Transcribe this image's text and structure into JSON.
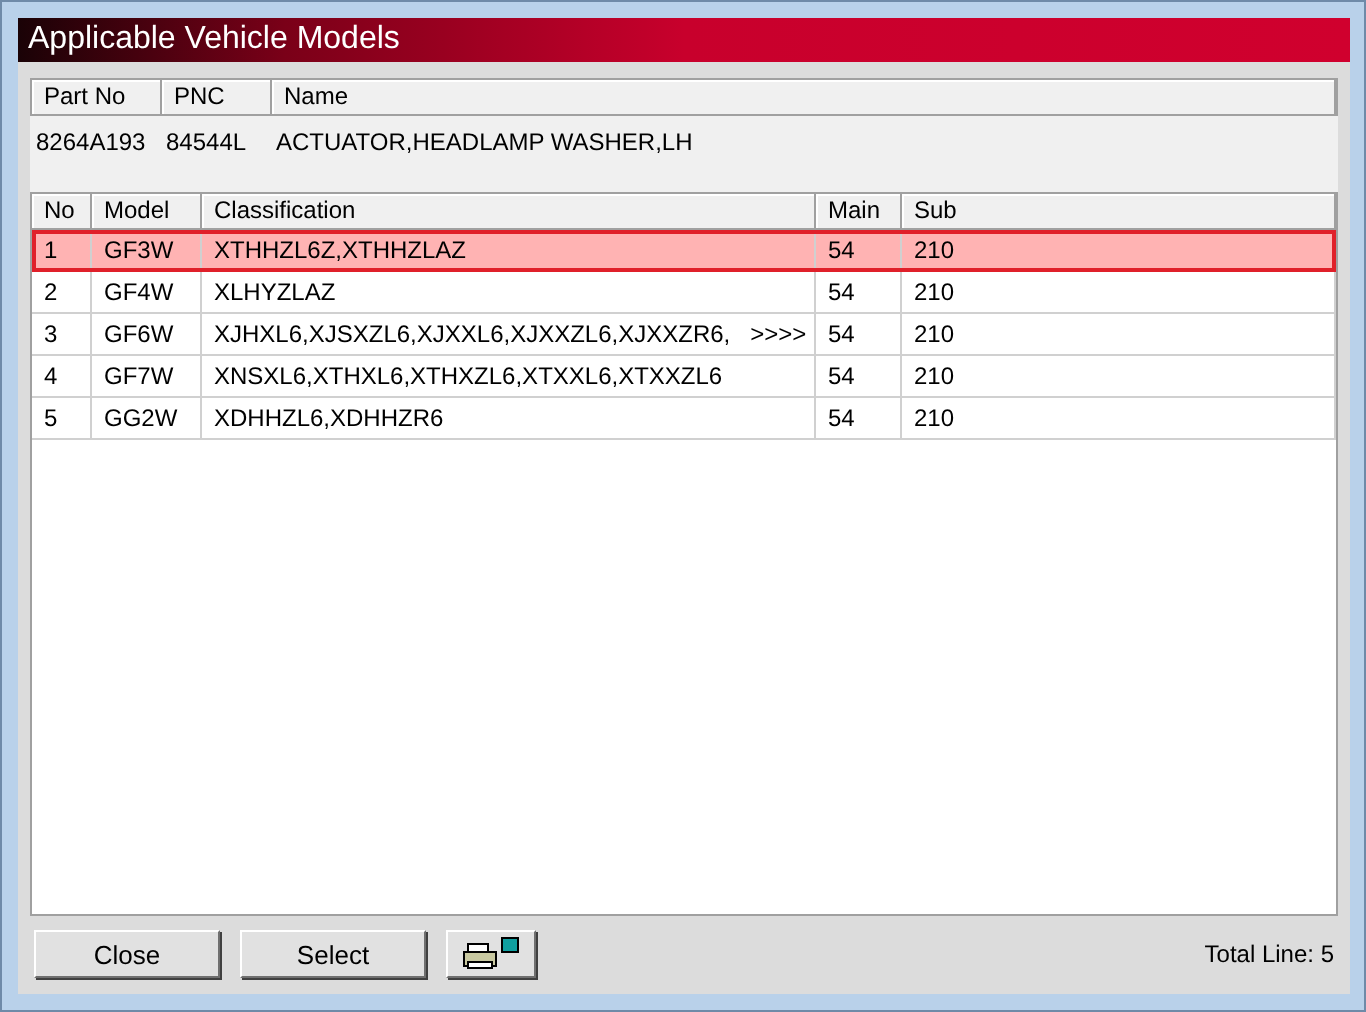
{
  "window": {
    "title": "Applicable Vehicle Models"
  },
  "part": {
    "columns": [
      "Part No",
      "PNC",
      "Name"
    ],
    "values": [
      "8264A193",
      "84544L",
      "ACTUATOR,HEADLAMP WASHER,LH"
    ]
  },
  "table": {
    "columns": [
      "No",
      "Model",
      "Classification",
      "Main",
      "Sub"
    ],
    "rows": [
      {
        "selected": true,
        "cells": [
          "1",
          "GF3W",
          "XTHHZL6Z,XTHHZLAZ",
          "54",
          "210"
        ]
      },
      {
        "selected": false,
        "cells": [
          "2",
          "GF4W",
          "XLHYZLAZ",
          "54",
          "210"
        ]
      },
      {
        "selected": false,
        "cells": [
          "3",
          "GF6W",
          "XJHXL6,XJSXZL6,XJXXL6,XJXXZL6,XJXXZR6,   >>>>",
          "54",
          "210"
        ]
      },
      {
        "selected": false,
        "cells": [
          "4",
          "GF7W",
          "XNSXL6,XTHXL6,XTHXZL6,XTXXL6,XTXXZL6",
          "54",
          "210"
        ]
      },
      {
        "selected": false,
        "cells": [
          "5",
          "GG2W",
          "XDHHZL6,XDHHZR6",
          "54",
          "210"
        ]
      }
    ]
  },
  "buttons": [
    "Close",
    "Select"
  ],
  "status": "Total Line: 5"
}
